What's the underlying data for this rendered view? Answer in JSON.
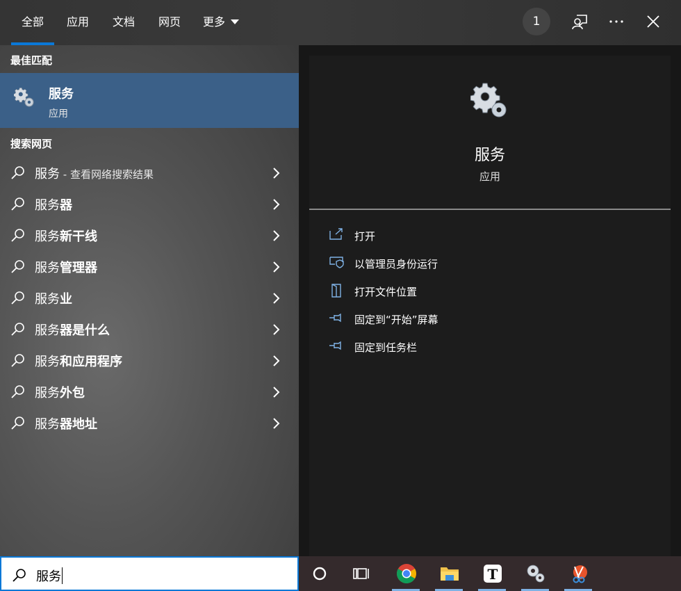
{
  "tabs": [
    "全部",
    "应用",
    "文档",
    "网页",
    "更多"
  ],
  "badge_count": "1",
  "left": {
    "best_match_title": "最佳匹配",
    "best_match": {
      "name": "服务",
      "type": "应用",
      "icon": "services-gear-icon"
    },
    "web_title": "搜索网页",
    "web_first": {
      "prefix": "服务",
      "suffix": " - 查看网络搜索结果"
    },
    "suggestions": [
      {
        "prefix": "服务",
        "bold": "器"
      },
      {
        "prefix": "服务",
        "bold": "新干线"
      },
      {
        "prefix": "服务",
        "bold": "管理器"
      },
      {
        "prefix": "服务",
        "bold": "业"
      },
      {
        "prefix": "服务",
        "bold": "器是什么"
      },
      {
        "prefix": "服务",
        "bold": "和应用程序"
      },
      {
        "prefix": "服务",
        "bold": "外包"
      },
      {
        "prefix": "服务",
        "bold": "器地址"
      }
    ]
  },
  "right": {
    "name": "服务",
    "type": "应用",
    "actions": [
      "打开",
      "以管理员身份运行",
      "打开文件位置",
      "固定到“开始”屏幕",
      "固定到任务栏"
    ]
  },
  "search": {
    "query": "服务"
  },
  "colors": {
    "accent": "#0a78d7",
    "selected": "#3b6088",
    "action_icon": "#7fb2e5"
  },
  "taskbar_icons": [
    "cortana-icon",
    "task-view-icon",
    "chrome-icon",
    "file-explorer-icon",
    "typora-icon",
    "services-icon",
    "snipping-tool-icon"
  ]
}
